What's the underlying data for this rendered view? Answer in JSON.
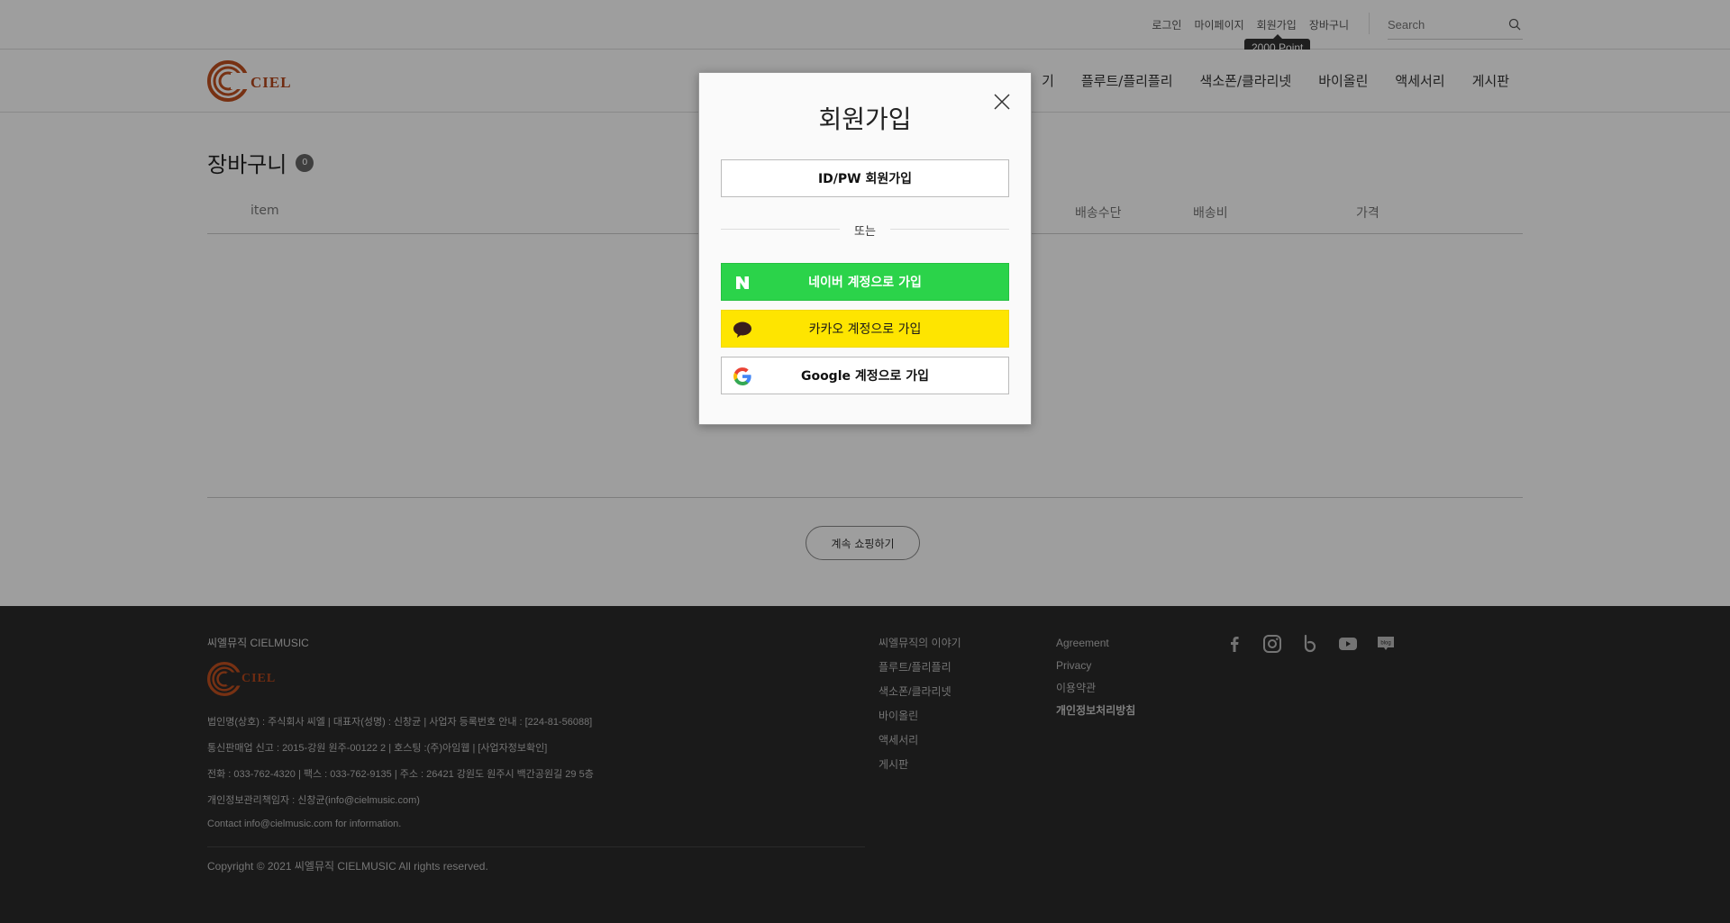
{
  "topbar": {
    "links": [
      "로그인",
      "마이페이지",
      "회원가입",
      "장바구니"
    ],
    "search_placeholder": "Search",
    "tooltip": "2000 Point"
  },
  "header": {
    "logo_text": "CIEL",
    "nav": [
      "기",
      "플루트/플리플리",
      "색소폰/클라리넷",
      "바이올린",
      "액세서리",
      "게시판"
    ]
  },
  "cart": {
    "title": "장바구니",
    "count": "0",
    "columns": {
      "item": "item",
      "shipping_method": "배송수단",
      "shipping_fee": "배송비",
      "price": "가격"
    },
    "continue_label": "계속 쇼핑하기"
  },
  "modal": {
    "title": "회원가입",
    "id_signup": "ID/PW 회원가입",
    "or": "또는",
    "naver": "네이버 계정으로 가입",
    "kakao": "카카오 계정으로 가입",
    "google": "Google 계정으로 가입",
    "colors": {
      "naver": "#2bd34a",
      "kakao": "#fee500"
    }
  },
  "footer": {
    "company": "씨엘뮤직 CIELMUSIC",
    "logo_text": "CIEL",
    "info": [
      "법인명(상호) : 주식회사 씨엘  |  대표자(성명) : 신창균 | 사업자 등록번호 안내 : [224-81-56088]",
      "통신판매업 신고 : 2015-강원 원주-00122 2 |  호스팅 :(주)아임웹 |  [사업자정보확인]",
      "전화 : 033-762-4320  |  팩스 : 033-762-9135 | 주소 : 26421 강원도 원주시 백간공원길 29 5층",
      "개인정보관리책임자 : 신창균(info@cielmusic.com)",
      "Contact info@cielmusic.com for information."
    ],
    "copyright": "Copyright © 2021 씨엘뮤직 CIELMUSIC All rights reserved.",
    "menu1": [
      "씨엘뮤직의 이야기",
      "플루트/플리플리",
      "색소폰/클라리넷",
      "바이올린",
      "액세서리",
      "게시판"
    ],
    "menu2": [
      "Agreement",
      "Privacy",
      "이용약관",
      "개인정보처리방침"
    ],
    "social": [
      "facebook-icon",
      "instagram-icon",
      "band-icon",
      "youtube-icon",
      "blog-icon"
    ],
    "blog_badge": "blog"
  }
}
